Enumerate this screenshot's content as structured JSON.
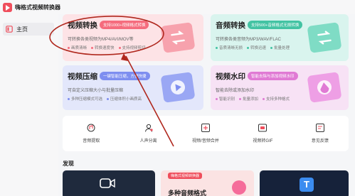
{
  "app": {
    "title": "嗨格式视频转换器"
  },
  "sidebar": {
    "home_label": "主页"
  },
  "cards": {
    "convert": {
      "title": "视频转换",
      "tag": "支持1000+视频格式转换",
      "desc": "可转换各类视频为MP4/AVI/MOV等",
      "features": [
        "画质清晰",
        "转换速度快",
        "支持视频剪切"
      ]
    },
    "audio": {
      "title": "音频转换",
      "tag": "支持500+音频格式无损转换",
      "desc": "可转换各类音频为MP3/WAV/FLAC",
      "features": [
        "音质清晰无损",
        "转换迅速",
        "批量处理"
      ]
    },
    "compress": {
      "title": "视频压缩",
      "tag": "一键智能压缩，方便快捷",
      "desc": "可自定义压缩大小与批量压缩",
      "features": [
        "多种压缩模式可选",
        "压缩体积小画质高"
      ]
    },
    "watermark": {
      "title": "视频水印",
      "tag": "智能去除与添加视频水印",
      "desc": "智能去除或添加水印",
      "features": [
        "智能识别",
        "批量添加",
        "支持多种格式"
      ]
    }
  },
  "tools": [
    {
      "label": "音频提取",
      "icon": "audio-extract-icon"
    },
    {
      "label": "人声分离",
      "icon": "vocal-separate-icon"
    },
    {
      "label": "视频/音频合并",
      "icon": "merge-icon"
    },
    {
      "label": "视频转GIF",
      "icon": "gif-icon"
    },
    {
      "label": "意见反馈",
      "icon": "feedback-icon"
    }
  ],
  "discover": {
    "title": "发现",
    "banners": [
      {
        "text": "",
        "tag": ""
      },
      {
        "tag": "嗨格式视频转换器",
        "text": "多种音频格式"
      },
      {
        "text": "",
        "tag": ""
      }
    ]
  },
  "colors": {
    "convert_bg": "#fde3e6",
    "audio_bg": "#d9f4ee",
    "compress_bg": "#e3e7fb",
    "watermark_bg": "#f7e2f5",
    "annotation_red": "#b0281e"
  }
}
